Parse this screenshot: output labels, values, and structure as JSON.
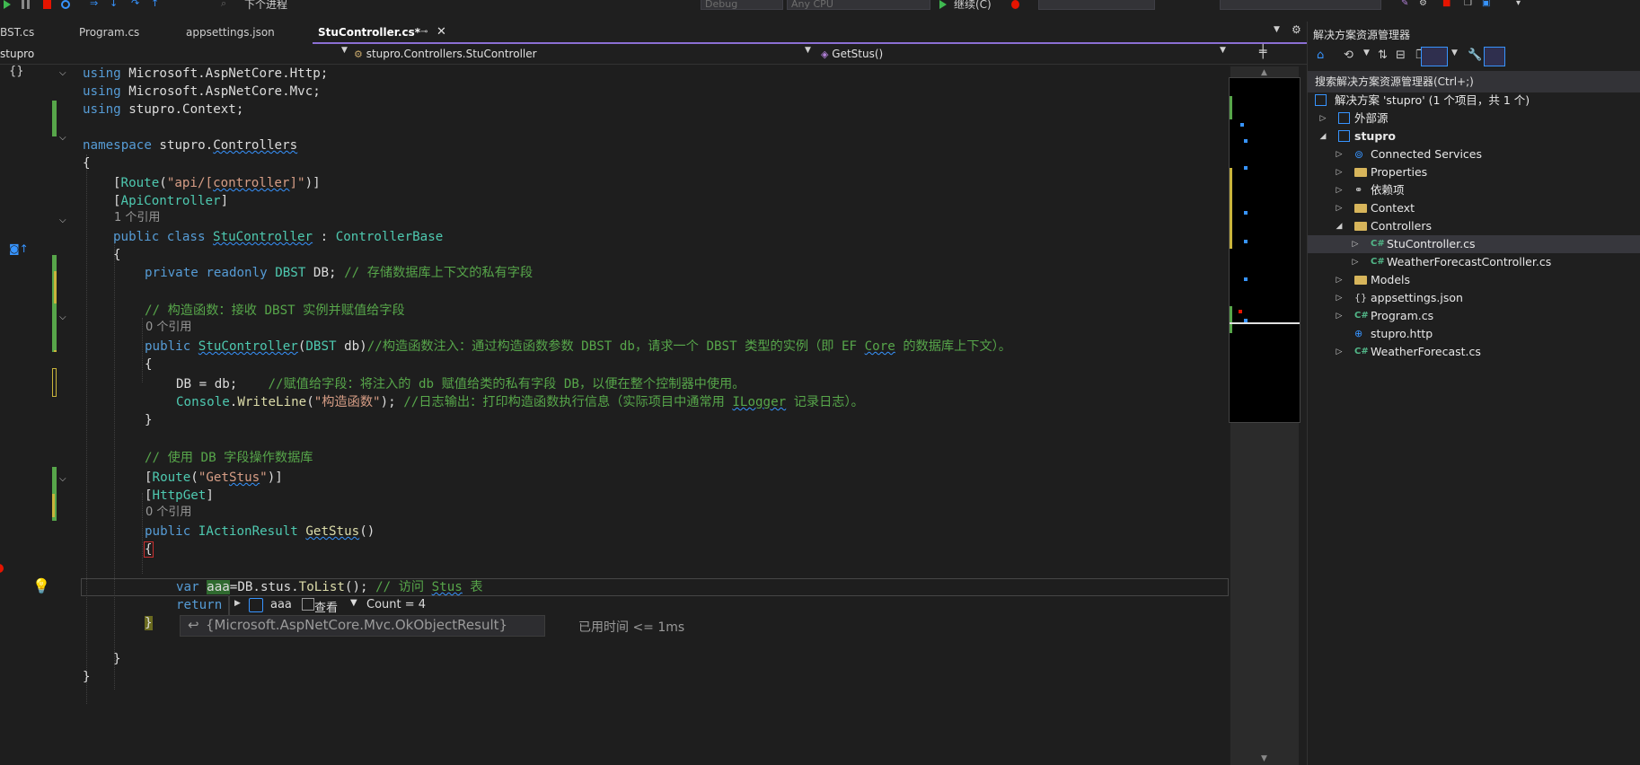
{
  "toolbar": {
    "forward_label": "下个进程",
    "config_value": "Debug",
    "platform_value": "Any CPU",
    "run_label": "继续(C)"
  },
  "tabs": [
    {
      "label": "BST.cs"
    },
    {
      "label": "Program.cs"
    },
    {
      "label": "appsettings.json"
    },
    {
      "label": "StuController.cs*",
      "active": true
    }
  ],
  "navbar": {
    "project": "stupro",
    "class_path": "stupro.Controllers.StuController",
    "member": "GetStus()"
  },
  "code": {
    "l1_kw": "using",
    "l1_ns": "Microsoft.AspNetCore.Http;",
    "l2_kw": "using",
    "l2_ns": "Microsoft.AspNetCore.Mvc;",
    "l3_kw": "using",
    "l3_ns": "stupro.Context;",
    "l4_kw": "namespace",
    "l4_a": "stupro.",
    "l4_b": "Controllers",
    "l5": "{",
    "l6_a": "[",
    "l6_b": "Route",
    "l6_c": "(",
    "l6_d": "\"api/[",
    "l6_e": "controller",
    "l6_f": "]\"",
    "l6_g": ")]",
    "l7_a": "[",
    "l7_b": "ApiController",
    "l7_c": "]",
    "lens1": "1 个引用",
    "l8_kw": "public class",
    "l8_name": "StuController",
    "l8_sep": " : ",
    "l8_base": "ControllerBase",
    "l9": "{",
    "l10_kw": "private readonly",
    "l10_ty": "DBST",
    "l10_id": " DB;",
    "l10_cm": "// 存储数据库上下文的私有字段",
    "l11_cm": "// 构造函数：接收 DBST 实例并赋值给字段",
    "lens2": "0 个引用",
    "l12_kw": "public",
    "l12_name": "StuController",
    "l12_a": "(",
    "l12_ty": "DBST",
    "l12_b": " db)",
    "l12_cm1": "//构造函数注入：通过构造函数参数 DBST db，请求一个 DBST 类型的实例（即 EF ",
    "l12_cm2": "Core",
    "l12_cm3": " 的数据库上下文）。",
    "l13": "{",
    "l14_a": "DB = db;",
    "l14_cm": "//赋值给字段：将注入的 db 赋值给类的私有字段 DB，以便在整个控制器中使用。",
    "l15_ty": "Console",
    "l15_a": ".",
    "l15_me": "WriteLine",
    "l15_b": "(",
    "l15_st": "\"构造函数\"",
    "l15_c": ");",
    "l15_cm1": "//日志输出：打印构造函数执行信息（实际项目中通常用 ",
    "l15_cm2": "ILogger",
    "l15_cm3": " 记录日志）。",
    "l16": "}",
    "l17_cm": "// 使用 DB 字段操作数据库",
    "l18_a": "[",
    "l18_b": "Route",
    "l18_c": "(",
    "l18_d": "\"Get",
    "l18_e": "Stus",
    "l18_f": "\"",
    "l18_g": ")]",
    "l19_a": "[",
    "l19_b": "HttpGet",
    "l19_c": "]",
    "lens3": "0 个引用",
    "l20_kw": "public",
    "l20_ty": "IActionResult",
    "l20_name": "GetStus",
    "l20_b": "()",
    "l21": "{",
    "l22_kw": "var",
    "l22_var": "aaa",
    "l22_a": "=DB.stus.",
    "l22_me": "ToList",
    "l22_b": "();",
    "l22_cm1": "// 访问 ",
    "l22_cm2": "Stus",
    "l22_cm3": " 表",
    "l23_kw": "return",
    "l24": "}",
    "l25": "}",
    "l26": "}"
  },
  "datatip": {
    "var_name": "aaa",
    "view_label": "查看",
    "count": "Count = 4"
  },
  "return_value": "{Microsoft.AspNetCore.Mvc.OkObjectResult}",
  "elapsed": "已用时间 <= 1ms",
  "solution_explorer": {
    "title": "解决方案资源管理器",
    "search_placeholder": "搜索解决方案资源管理器(Ctrl+;)",
    "solution": "解决方案 'stupro' (1 个项目，共 1 个)",
    "items": [
      {
        "label": "外部源"
      },
      {
        "label": "stupro"
      },
      {
        "label": "Connected Services"
      },
      {
        "label": "Properties"
      },
      {
        "label": "依赖项"
      },
      {
        "label": "Context"
      },
      {
        "label": "Controllers"
      },
      {
        "label": "StuController.cs"
      },
      {
        "label": "WeatherForecastController.cs"
      },
      {
        "label": "Models"
      },
      {
        "label": "appsettings.json"
      },
      {
        "label": "Program.cs"
      },
      {
        "label": "stupro.http"
      },
      {
        "label": "WeatherForecast.cs"
      }
    ],
    "cs_glyph": "C#"
  },
  "colors": {
    "accent": "#8b6fd4",
    "change_saved": "#57a64a",
    "change_unsaved": "#c9b43b",
    "breakpoint": "#e51400"
  }
}
